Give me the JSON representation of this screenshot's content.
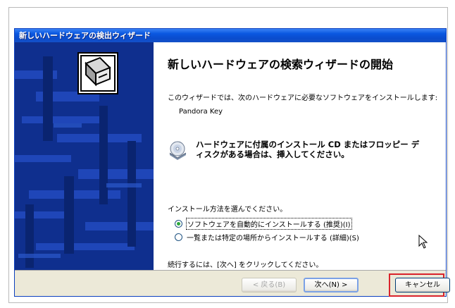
{
  "window": {
    "title": "新しいハードウェアの検出ウィザード"
  },
  "content": {
    "heading": "新しいハードウェアの検索ウィザードの開始",
    "intro": "このウィザードでは、次のハードウェアに必要なソフトウェアをインストールします:",
    "device_name": "Pandora Key",
    "cd_instruction": "ハードウェアに付属のインストール CD またはフロッピー ディスクがある場合は、挿入してください。",
    "select_prompt": "インストール方法を選んでください。",
    "options": [
      {
        "label": "ソフトウェアを自動的にインストールする (推奨)(I)",
        "selected": true
      },
      {
        "label": "一覧または特定の場所からインストールする (詳細)(S)",
        "selected": false
      }
    ],
    "continue_text": "続行するには、[次へ] をクリックしてください。"
  },
  "buttons": {
    "back": "< 戻る(B)",
    "next": "次へ(N) >",
    "cancel": "キャンセル"
  },
  "colors": {
    "titlebar": "#0a4ccd",
    "banner": "#0f2f8e",
    "highlight": "#d9232b"
  },
  "icons": [
    "hardware-icon",
    "cd-icon",
    "mouse-cursor-icon"
  ]
}
